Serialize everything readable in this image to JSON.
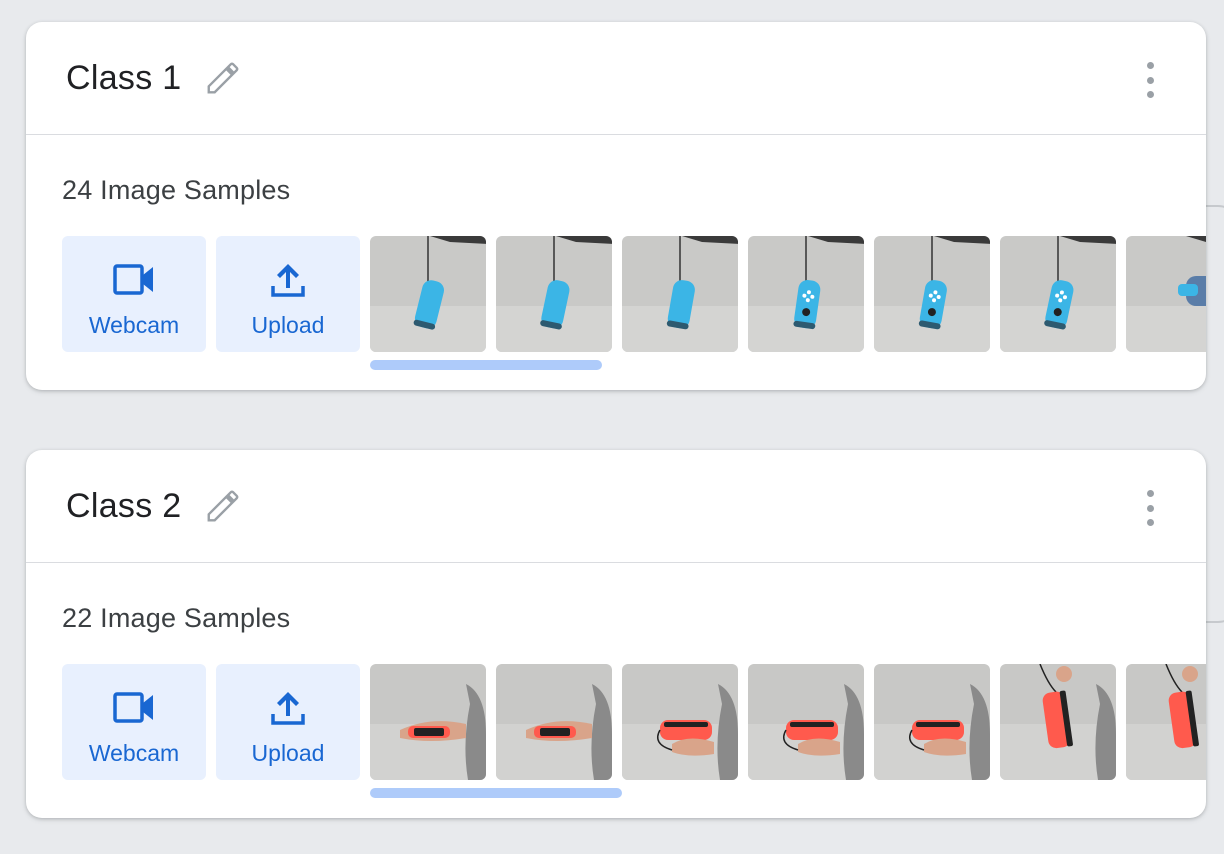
{
  "colors": {
    "accent": "#1967d2",
    "button_bg": "#e8f0fe",
    "scroll_thumb": "#aecbfa",
    "blue_controller": "#3bb5e6",
    "red_controller": "#ff5a4d"
  },
  "classes": [
    {
      "title": "Class 1",
      "samples_label": "24 Image Samples",
      "webcam_label": "Webcam",
      "upload_label": "Upload",
      "thumbnail_kind": "blue-joycon",
      "visible_thumbnails": 7
    },
    {
      "title": "Class 2",
      "samples_label": "22 Image Samples",
      "webcam_label": "Webcam",
      "upload_label": "Upload",
      "thumbnail_kind": "red-joycon",
      "visible_thumbnails": 7
    }
  ],
  "icons": {
    "edit": "pencil-icon",
    "menu": "more-vert-icon",
    "webcam": "videocam-icon",
    "upload": "upload-icon"
  }
}
